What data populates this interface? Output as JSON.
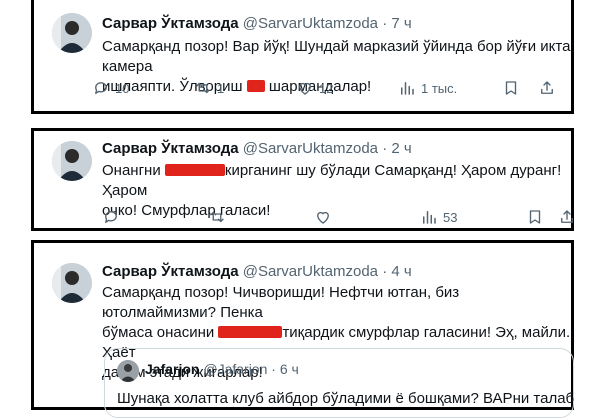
{
  "tweets": [
    {
      "name": "Сарвар Ўктамзода",
      "handle": "@SarvarUktamzoda",
      "time": "· 7 ч",
      "lines": [
        "Самарқанд позор! Вар йўқ! Шундай марказий ўйинда бор йўғи икта камера",
        "ишлаяпти. Ўлвориш",
        "шармандалар!"
      ],
      "replies": "10",
      "retweets": "1",
      "likes": "12",
      "views": "1 тыс."
    },
    {
      "name": "Сарвар Ўктамзода",
      "handle": "@SarvarUktamzoda",
      "time": "· 2 ч",
      "lines": [
        "Онангни",
        "кирганинг шу бўлади Самарқанд! Ҳаром дуранг! Ҳаром",
        "очко! Смурфлар галаси!"
      ],
      "views": "53"
    },
    {
      "name": "Сарвар Ўктамзода",
      "handle": "@SarvarUktamzoda",
      "time": "· 4 ч",
      "lines": [
        "Самарқанд позор! Чичворишди! Нефтчи ютган, биз ютолмаймизми? Пенка",
        "бўмаса онасини",
        "тиқардик смурфлар галасини! Эҳ, майли. Ҳаёт",
        "давом этади жигарлар!"
      ]
    }
  ],
  "quote": {
    "name": "Jafarjon",
    "handle": "@Jafarjon",
    "time": "· 6 ч",
    "text": "Шунақа холатта клуб айбдор бўладими ё бошқами? ВАРни талаб"
  },
  "colors": {
    "redaction": "#e0241b",
    "muted": "#536471",
    "text": "#0f1419",
    "border": "#000000"
  }
}
